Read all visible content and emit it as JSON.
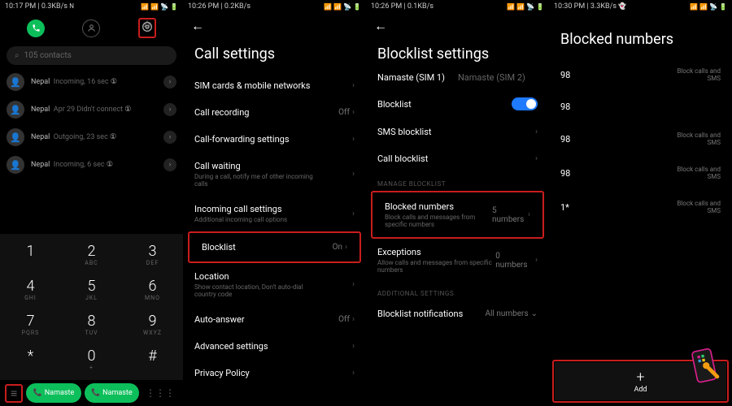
{
  "s1": {
    "status": {
      "time": "10:17 PM",
      "speed": "0.3KB/s"
    },
    "search_placeholder": "105 contacts",
    "log": [
      {
        "name": "Nepal",
        "meta": "Incoming, 16 sec",
        "i": "①"
      },
      {
        "name": "Nepal",
        "meta": "Apr 29 Didn't connect",
        "i": "①"
      },
      {
        "name": "Nepal",
        "meta": "Outgoing, 23 sec",
        "i": "①"
      },
      {
        "name": "Nepal",
        "meta": "Incoming, 6 sec",
        "i": "①"
      }
    ],
    "keys": [
      [
        "1",
        ""
      ],
      [
        "2",
        "ABC"
      ],
      [
        "3",
        "DEF"
      ],
      [
        "4",
        "GHI"
      ],
      [
        "5",
        "JKL"
      ],
      [
        "6",
        "MNO"
      ],
      [
        "7",
        "PQRS"
      ],
      [
        "8",
        "TUV"
      ],
      [
        "9",
        "WXYZ"
      ],
      [
        "*",
        ""
      ],
      [
        "0",
        "+"
      ],
      [
        "#",
        ""
      ]
    ],
    "call_label": "Namaste"
  },
  "s2": {
    "status": {
      "time": "10:26 PM",
      "speed": "0.2KB/s"
    },
    "title": "Call settings",
    "items": [
      {
        "lbl": "SIM cards & mobile networks"
      },
      {
        "lbl": "Call recording",
        "val": "Off"
      },
      {
        "lbl": "Call-forwarding settings"
      },
      {
        "lbl": "Call waiting",
        "desc": "During a call, notify me of other incoming calls"
      },
      {
        "lbl": "Incoming call settings",
        "desc": "Additional incoming call options"
      },
      {
        "lbl": "Blocklist",
        "val": "On",
        "hl": true
      },
      {
        "lbl": "Location",
        "desc": "Show contact location, Don't auto-dial country code"
      },
      {
        "lbl": "Auto-answer",
        "val": "Off"
      },
      {
        "lbl": "Advanced settings"
      },
      {
        "lbl": "Privacy Policy"
      }
    ]
  },
  "s3": {
    "status": {
      "time": "10:26 PM",
      "speed": "0.1KB/s"
    },
    "title": "Blocklist settings",
    "sims": [
      "Namaste (SIM 1)",
      "Namaste (SIM 2)"
    ],
    "items": [
      {
        "lbl": "Blocklist",
        "toggle": true
      },
      {
        "lbl": "SMS blocklist"
      },
      {
        "lbl": "Call blocklist"
      }
    ],
    "sect1": "MANAGE BLOCKLIST",
    "manage": [
      {
        "lbl": "Blocked numbers",
        "desc": "Block calls and messages from specific numbers",
        "val": "5 numbers",
        "hl": true
      },
      {
        "lbl": "Exceptions",
        "desc": "Allow calls and messages from specific numbers",
        "val": "0 numbers"
      }
    ],
    "sect2": "ADDITIONAL SETTINGS",
    "extra": {
      "lbl": "Blocklist notifications",
      "val": "All numbers"
    }
  },
  "s4": {
    "status": {
      "time": "10:30 PM",
      "speed": "3.3KB/s"
    },
    "title": "Blocked numbers",
    "nums": [
      {
        "n": "98",
        "d": "Block calls and SMS"
      },
      {
        "n": "98",
        "d": ""
      },
      {
        "n": "98",
        "d": "Block calls and SMS"
      },
      {
        "n": "98",
        "d": "Block calls and SMS"
      },
      {
        "n": "1*",
        "d": "Block calls and SMS"
      }
    ],
    "add": "Add"
  }
}
